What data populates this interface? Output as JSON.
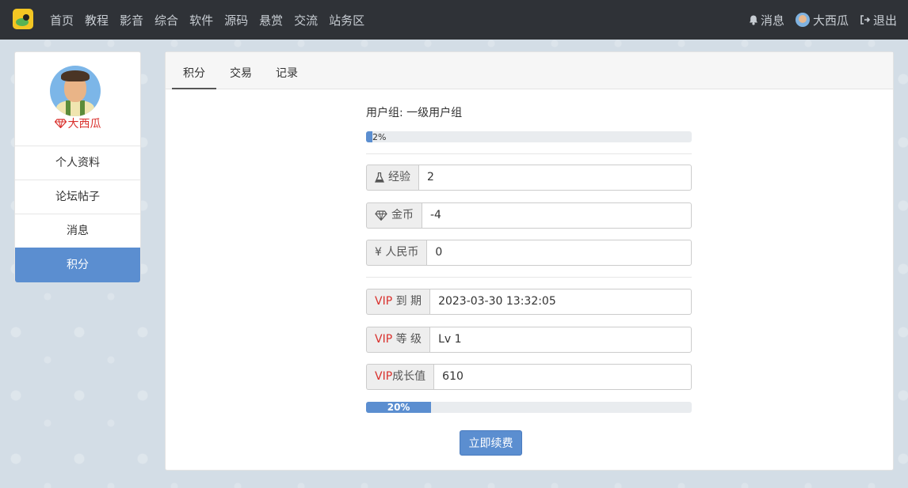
{
  "nav": {
    "items": [
      "首页",
      "教程",
      "影音",
      "综合",
      "软件",
      "源码",
      "悬赏",
      "交流",
      "站务区"
    ],
    "messages": "消息",
    "username": "大西瓜",
    "logout": "退出"
  },
  "sidebar": {
    "username": "大西瓜",
    "items": [
      {
        "label": "个人资料",
        "active": false
      },
      {
        "label": "论坛帖子",
        "active": false
      },
      {
        "label": "消息",
        "active": false
      },
      {
        "label": "积分",
        "active": true
      }
    ]
  },
  "tabs": [
    "积分",
    "交易",
    "记录"
  ],
  "credits": {
    "user_group_label": "用户组: 一级用户组",
    "level_progress": {
      "percent": 2,
      "text": "2%"
    },
    "exp_label": "经验",
    "exp_value": "2",
    "coins_label": "金币",
    "coins_value": "-4",
    "rmb_label": "¥ 人民币",
    "rmb_value": "0",
    "vip_expire_prefix": "VIP",
    "vip_expire_label": " 到 期",
    "vip_expire_value": "2023-03-30 13:32:05",
    "vip_level_prefix": "VIP",
    "vip_level_label": " 等 级",
    "vip_level_value": "Lv 1",
    "vip_growth_prefix": "VIP",
    "vip_growth_label": "成长值",
    "vip_growth_value": "610",
    "vip_progress": {
      "percent": 20,
      "text": "20%"
    },
    "renew_button": "立即续费"
  },
  "colors": {
    "accent": "#5b8ed0",
    "navbar": "#2f3237",
    "vip_red": "#d9302c"
  }
}
